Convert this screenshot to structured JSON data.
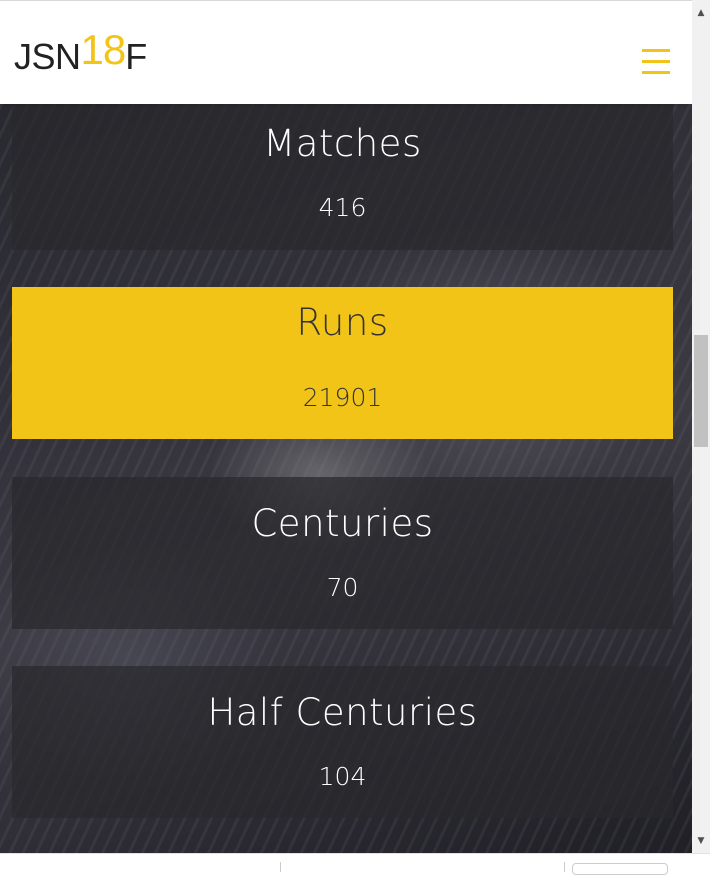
{
  "header": {
    "logo": {
      "part1": "JSN",
      "part2": "18",
      "part3": "F"
    },
    "menu_icon": "hamburger-menu-icon"
  },
  "stats": [
    {
      "label": "Matches",
      "value": "416"
    },
    {
      "label": "Runs",
      "value": "21901"
    },
    {
      "label": "Centuries",
      "value": "70"
    },
    {
      "label": "Half Centuries",
      "value": "104"
    }
  ],
  "colors": {
    "accent": "#f2c417",
    "dark_text": "#222222",
    "card_bg": "#28282d",
    "header_bg": "#ffffff"
  }
}
